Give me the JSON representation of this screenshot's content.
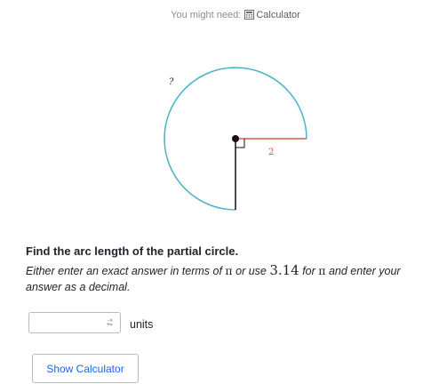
{
  "hint": {
    "prefix": "You might need:",
    "calculator_label": "Calculator"
  },
  "diagram": {
    "unknown_label": "?",
    "radius_label": "2",
    "colors": {
      "arc": "#4ab3c9",
      "radius": "#e05a4f",
      "vertical_radius": "#111111",
      "center": "#111111"
    },
    "arc_sweep_degrees": 270
  },
  "question": {
    "title": "Find the arc length of the partial circle.",
    "instruction_part1": "Either enter an exact answer in terms of ",
    "pi": "π",
    "instruction_part2": " or use ",
    "approx_value": "3.14",
    "instruction_part3": " for ",
    "instruction_part4": " and enter your answer as a decimal."
  },
  "answer": {
    "value": "",
    "keypad_icon": "math-keypad-icon",
    "units_label": "units"
  },
  "buttons": {
    "show_calculator": "Show Calculator"
  },
  "colors": {
    "link": "#1865f2",
    "text": "#21242c",
    "hint": "#8a8d93"
  }
}
